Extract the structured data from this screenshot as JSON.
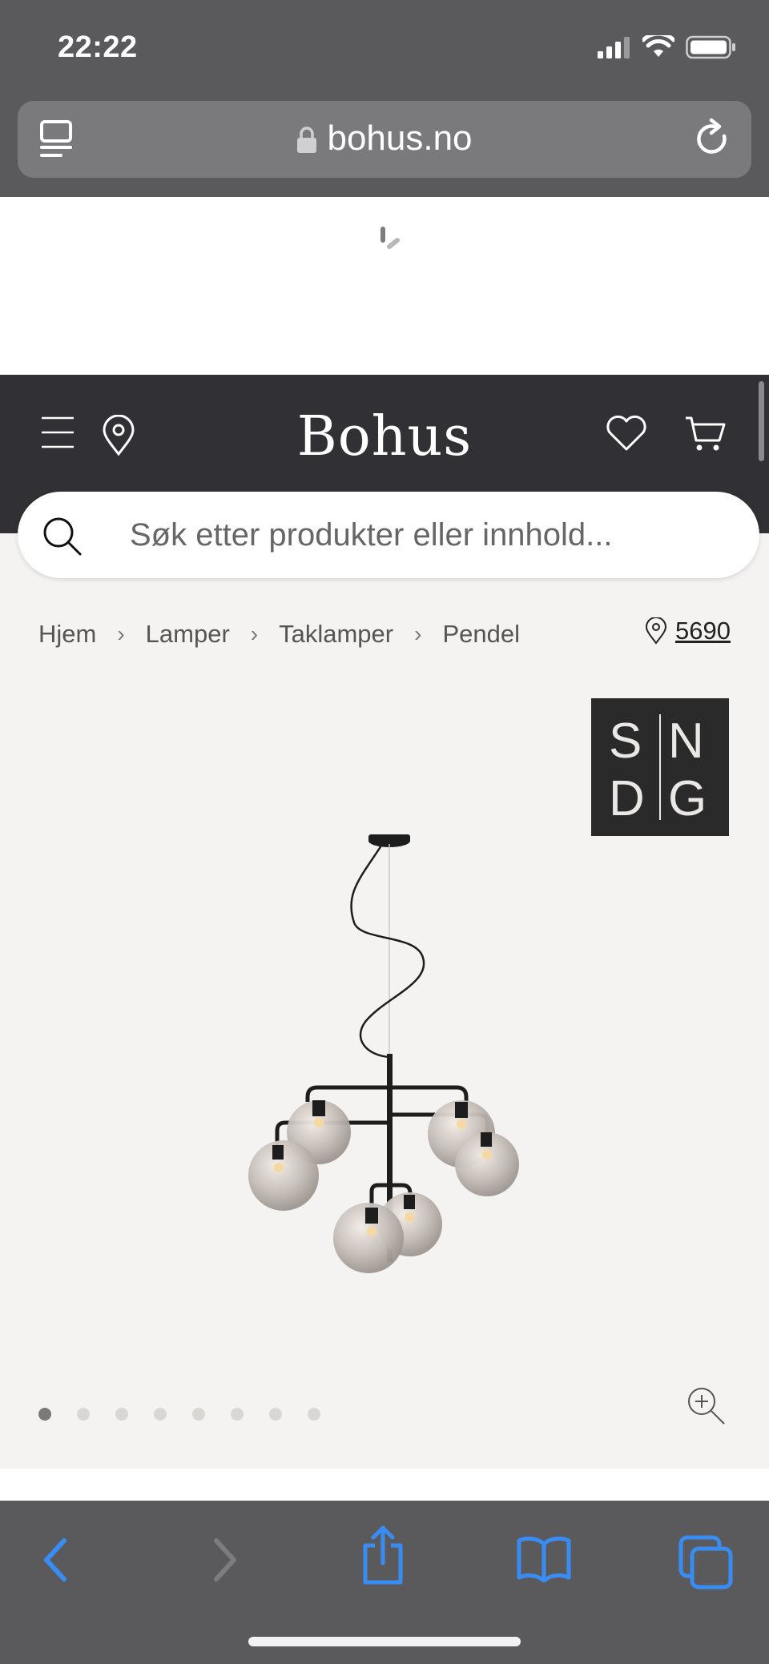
{
  "status_bar": {
    "time": "22:22"
  },
  "browser": {
    "domain": "bohus.no"
  },
  "header": {
    "logo": "Bohus"
  },
  "search": {
    "placeholder": "Søk etter produkter eller innhold..."
  },
  "breadcrumb": [
    {
      "label": "Hjem"
    },
    {
      "label": "Lamper"
    },
    {
      "label": "Taklamper"
    },
    {
      "label": "Pendel"
    }
  ],
  "location": {
    "postal_code": "5690"
  },
  "brand_badge": {
    "top_left": "S",
    "top_right": "N",
    "bottom_left": "D",
    "bottom_right": "G"
  },
  "carousel": {
    "image_count": 8,
    "active_index": 0
  },
  "colors": {
    "header_bg": "#313035",
    "page_bg": "#f4f3f1",
    "browser_chrome": "#5a5a5c",
    "ios_accent": "#3a8cf5"
  }
}
